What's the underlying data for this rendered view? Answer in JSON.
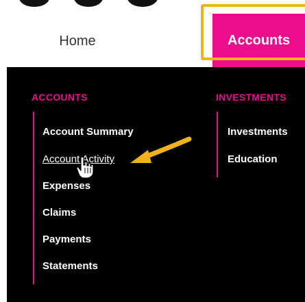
{
  "nav": {
    "home_label": "Home",
    "accounts_label": "Accounts"
  },
  "menu": {
    "accounts_heading": "ACCOUNTS",
    "investments_heading": "INVESTMENTS",
    "accounts_items": [
      "Account Summary",
      "Account Activity",
      "Expenses",
      "Claims",
      "Payments",
      "Statements"
    ],
    "investments_items": [
      "Investments",
      "Education"
    ]
  },
  "colors": {
    "brand_pink": "#ec0c8c",
    "highlight_orange": "#f2b21c",
    "menu_background": "#000000"
  },
  "icons": {
    "cursor": "hand-pointer-icon",
    "annotation": "arrow-icon"
  }
}
